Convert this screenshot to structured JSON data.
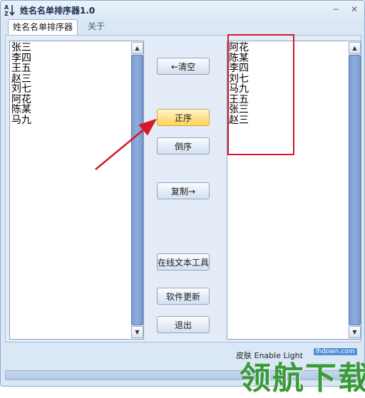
{
  "window": {
    "title": "姓名名单排序器1.0",
    "minimize_glyph": "−",
    "close_glyph": "✕"
  },
  "tabs": [
    {
      "label": "姓名名单排序器",
      "active": true
    },
    {
      "label": "关于",
      "active": false
    }
  ],
  "left_list": [
    "张三",
    "李四",
    "王五",
    "赵三",
    "刘七",
    "阿花",
    "陈某",
    "马九"
  ],
  "right_list": [
    "阿花",
    "陈某",
    "李四",
    "刘七",
    "马九",
    "王五",
    "张三",
    "赵三"
  ],
  "buttons": {
    "clear": "←清空",
    "ascending": "正序",
    "descending": "倒序",
    "copy": "复制→",
    "online_tools": "在线文本工具",
    "update": "软件更新",
    "exit": "退出"
  },
  "status": {
    "skin": "皮肤 Enable Light"
  },
  "watermark": {
    "site": "lhdown.com",
    "text": "领航下载"
  },
  "icons": {
    "app": "sort-az-icon",
    "scroll_up": "triangle-up-icon",
    "scroll_down": "triangle-down-icon"
  },
  "colors": {
    "highlight_button": "#ffd35c",
    "annotation_red": "#d6182a",
    "scroll_thumb": "#8cadde",
    "watermark_green": "#3a9b3a"
  }
}
